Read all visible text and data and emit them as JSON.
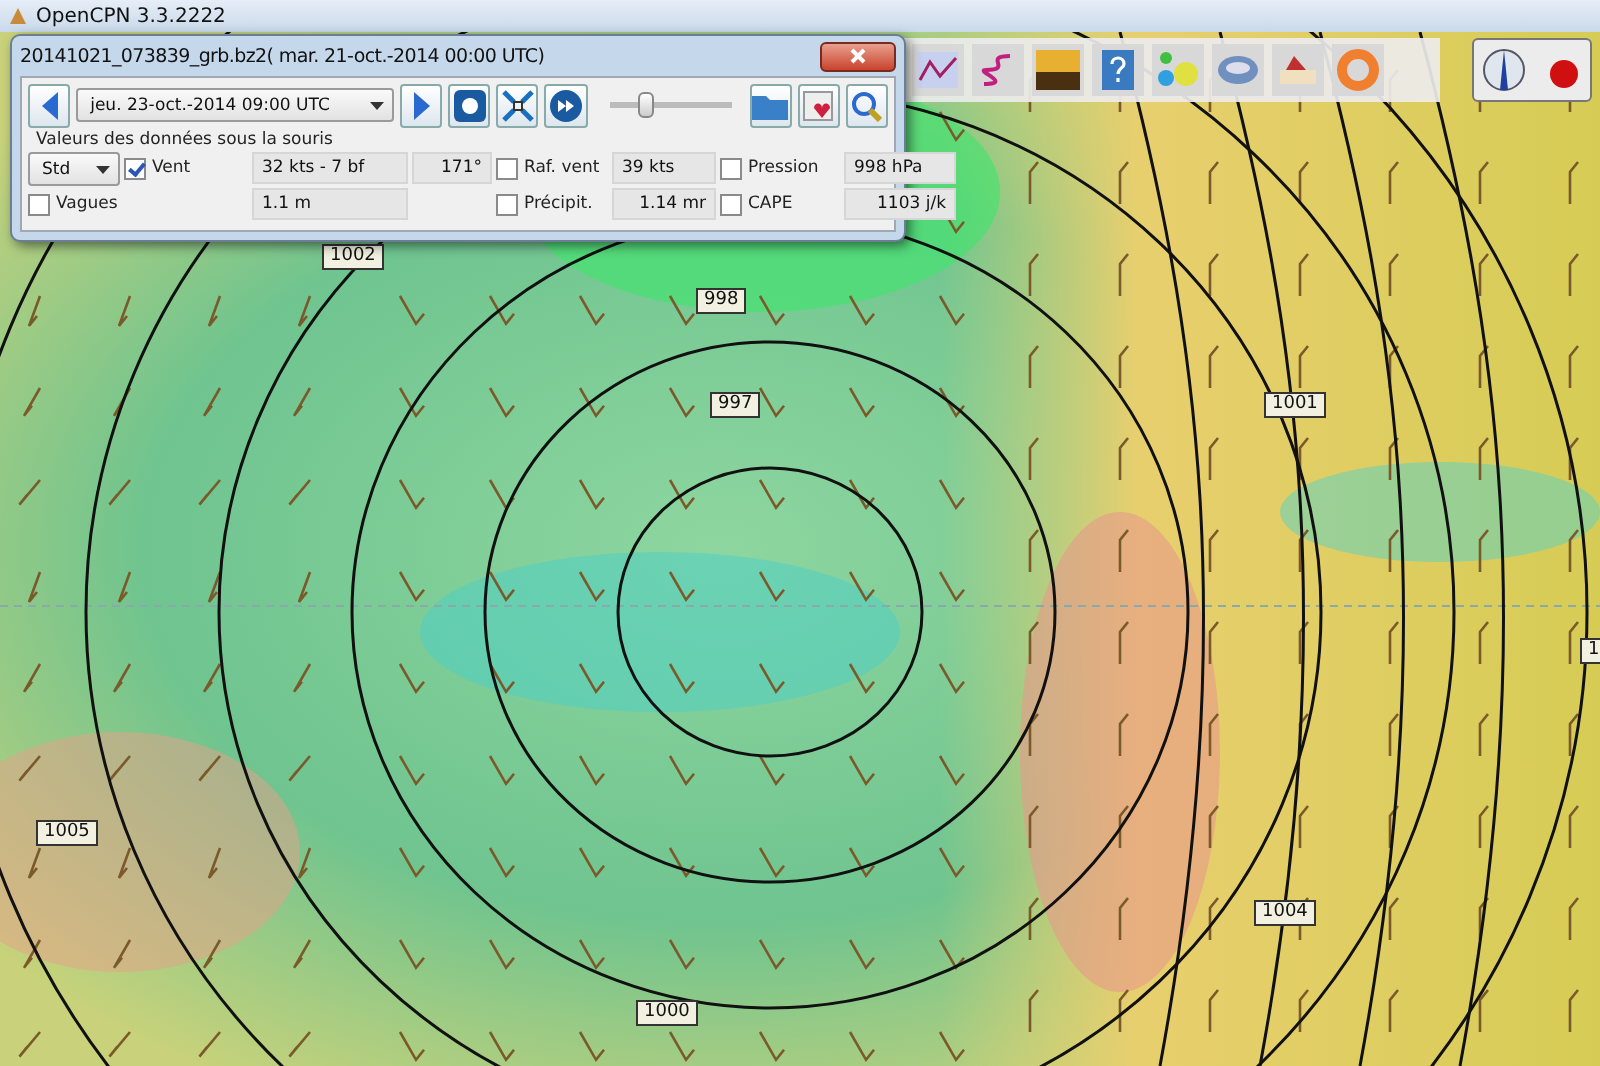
{
  "app": {
    "title": "OpenCPN 3.3.2222"
  },
  "grib_dialog": {
    "title": "20141021_073839_grb.bz2( mar. 21-oct.-2014 00:00  UTC)",
    "time_select": "jeu. 23-oct.-2014 09:00  UTC",
    "slider": {
      "level": 0.3
    },
    "section_label": "Valeurs des données sous la souris",
    "mode_select": "Std",
    "fields": [
      {
        "label": "Vent",
        "checked": true,
        "values": [
          "32 kts -  7 bf",
          "171°"
        ]
      },
      {
        "label": "Raf. vent",
        "checked": false,
        "values": [
          "39 kts"
        ]
      },
      {
        "label": "Pression",
        "checked": false,
        "values": [
          "998 hPa"
        ]
      },
      {
        "label": "Vagues",
        "checked": false,
        "values": [
          "1.1 m"
        ]
      },
      {
        "label": "Précipit.",
        "checked": false,
        "values": [
          "1.14 mr"
        ]
      },
      {
        "label": "CAPE",
        "checked": false,
        "values": [
          "1103 j/k"
        ]
      }
    ]
  },
  "isobar_labels": [
    {
      "label": "1002"
    },
    {
      "label": "998"
    },
    {
      "label": "997"
    },
    {
      "label": "1001"
    },
    {
      "label": "1"
    },
    {
      "label": "1005"
    },
    {
      "label": "1004"
    },
    {
      "label": "1000"
    }
  ]
}
